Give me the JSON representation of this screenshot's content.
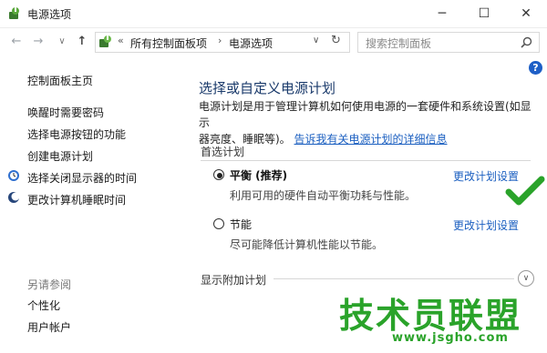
{
  "window": {
    "title": "电源选项",
    "buttons": {
      "minimize": "─",
      "maximize": "☐",
      "close": "✕"
    }
  },
  "navigation": {
    "back": "←",
    "forward": "→",
    "dropdown": "∨",
    "up": "↑",
    "address": {
      "crumbs": [
        "所有控制面板项",
        "电源选项"
      ],
      "prefix": "«",
      "separator": "›"
    },
    "search_placeholder": "搜索控制面板"
  },
  "sidebar": {
    "home": "控制面板主页",
    "links": [
      "唤醒时需要密码",
      "选择电源按钮的功能",
      "创建电源计划",
      "选择关闭显示器的时间",
      "更改计算机睡眠时间"
    ],
    "see_also_title": "另请参阅",
    "see_also": [
      "个性化",
      "用户帐户"
    ]
  },
  "main": {
    "title": "选择或自定义电源计划",
    "desc_line1": "电源计划是用于管理计算机如何使用电源的一套硬件和系统设置(如显示",
    "desc_line2_prefix": "器亮度、睡眠等)。",
    "desc_link": "告诉我有关电源计划的详细信息",
    "preferred_label": "首选计划",
    "plans": [
      {
        "name": "平衡 (推荐)",
        "description": "利用可用的硬件自动平衡功耗与性能。",
        "change": "更改计划设置",
        "selected": true
      },
      {
        "name": "节能",
        "description": "尽可能降低计算机性能以节能。",
        "change": "更改计划设置",
        "selected": false
      }
    ],
    "additional_label": "显示附加计划"
  },
  "watermark": {
    "text": "技术员联盟",
    "url": "www.jsgho.com"
  },
  "colors": {
    "link": "#1b5fc0",
    "title": "#1a3a6b",
    "watermark": "#2aa32a"
  }
}
